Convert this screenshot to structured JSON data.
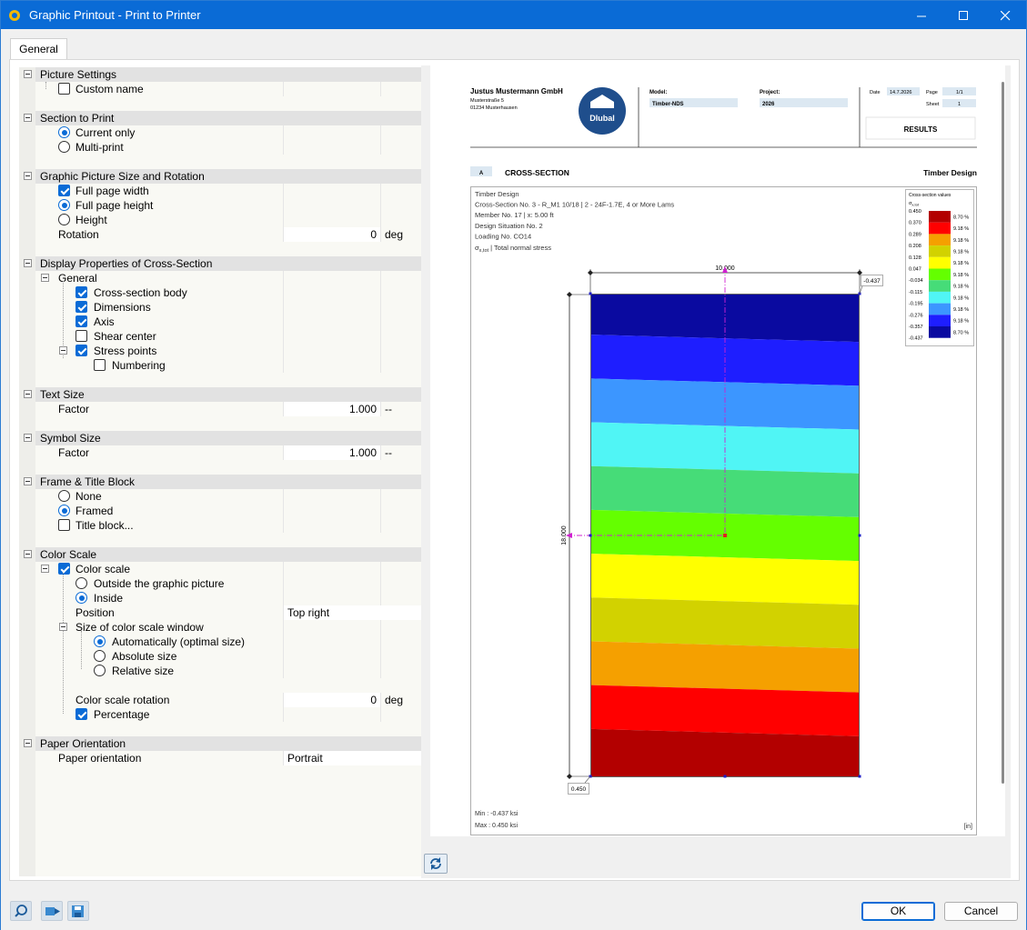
{
  "window": {
    "title": "Graphic Printout - Print to Printer"
  },
  "tabs": [
    {
      "label": "General"
    }
  ],
  "settings": {
    "picture_settings": {
      "title": "Picture Settings",
      "custom_name": "Custom name"
    },
    "section_to_print": {
      "title": "Section to Print",
      "current_only": "Current only",
      "multi_print": "Multi-print"
    },
    "size_rotation": {
      "title": "Graphic Picture Size and Rotation",
      "full_width": "Full page width",
      "full_height": "Full page height",
      "height": "Height",
      "rotation": "Rotation",
      "rotation_value": "0",
      "rotation_unit": "deg"
    },
    "display_props": {
      "title": "Display Properties of Cross-Section",
      "general": "General",
      "body": "Cross-section body",
      "dimensions": "Dimensions",
      "axis": "Axis",
      "shear_center": "Shear center",
      "stress_points": "Stress points",
      "numbering": "Numbering"
    },
    "text_size": {
      "title": "Text Size",
      "factor": "Factor",
      "value": "1.000",
      "unit": "--"
    },
    "symbol_size": {
      "title": "Symbol Size",
      "factor": "Factor",
      "value": "1.000",
      "unit": "--"
    },
    "frame": {
      "title": "Frame & Title Block",
      "none": "None",
      "framed": "Framed",
      "title_block": "Title block..."
    },
    "color_scale": {
      "title": "Color Scale",
      "color_scale": "Color scale",
      "outside": "Outside the graphic picture",
      "inside": "Inside",
      "position": "Position",
      "position_value": "Top right",
      "size_window": "Size of color scale window",
      "auto": "Automatically (optimal size)",
      "absolute": "Absolute size",
      "relative": "Relative size",
      "rotation": "Color scale rotation",
      "rotation_value": "0",
      "rotation_unit": "deg",
      "percentage": "Percentage"
    },
    "paper": {
      "title": "Paper Orientation",
      "label": "Paper orientation",
      "value": "Portrait"
    }
  },
  "report": {
    "company": "Justus Mustermann GmbH",
    "street": "Musterstraße 5",
    "city": "01234 Musterhausen",
    "logo_text": "Dlubal",
    "model_label": "Model:",
    "model_value": "Timber-NDS",
    "project_label": "Project:",
    "project_value": "2026",
    "date_label": "Date",
    "date_value": "14.7.2026",
    "page_label": "Page",
    "page_value": "1/1",
    "sheet_label": "Sheet",
    "sheet_value": "1",
    "results": "RESULTS",
    "section_letter": "A",
    "section_title": "CROSS-SECTION",
    "section_right": "Timber Design",
    "info": [
      "Timber Design",
      "Cross-Section No. 3 - R_M1 10/18 | 2 - 24F-1.7E, 4 or More Lams",
      "Member No. 17 | x: 5.00 ft",
      "Design Situation No. 2",
      "Loading No. CO14"
    ],
    "stress_symbol": "σ",
    "stress_sub": "x,tot",
    "stress_desc": " | Total normal stress",
    "legend_title": "Cross-section values",
    "legend_symbol": "σ",
    "legend_sub": "x,tot",
    "legend_values": [
      "0.450",
      "0.370",
      "0.289",
      "0.208",
      "0.128",
      "0.047",
      "-0.034",
      "-0.115",
      "-0.195",
      "-0.276",
      "-0.357",
      "-0.437"
    ],
    "legend_percents": [
      "8.70 %",
      "9.18 %",
      "9.18 %",
      "9.18 %",
      "9.18 %",
      "9.18 %",
      "9.18 %",
      "9.18 %",
      "9.18 %",
      "9.18 %",
      "8.70 %"
    ],
    "legend_colors": [
      "#b30000",
      "#ff0000",
      "#f5a000",
      "#d2d200",
      "#ffff00",
      "#64ff00",
      "#46dc78",
      "#50f5f5",
      "#3c96ff",
      "#1e1eff",
      "#0a0aa0"
    ],
    "band_colors": [
      "#0a0aa0",
      "#1e1eff",
      "#3c96ff",
      "#50f5f5",
      "#46dc78",
      "#64ff00",
      "#ffff00",
      "#d2d200",
      "#f5a000",
      "#ff0000",
      "#b30000"
    ],
    "dim_top": "10.000",
    "dim_left": "18.000",
    "label_top": "-0.437",
    "label_bottom": "0.450",
    "min_text": "Min : -0.437 ksi",
    "max_text": "Max :  0.450 ksi",
    "unit_text": "[in]"
  },
  "buttons": {
    "ok": "OK",
    "cancel": "Cancel"
  },
  "colors": {
    "titlebar": "#0a6bd6",
    "accent": "#0a6bd6"
  }
}
